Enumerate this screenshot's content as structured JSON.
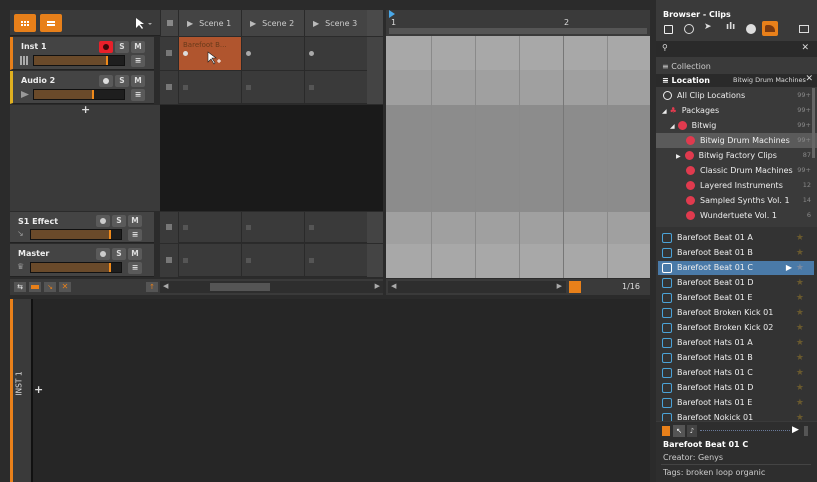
{
  "colors": {
    "accent": "#f08a1a",
    "record": "#e8202a",
    "selected_row": "#4a7aa8",
    "browser_icon": "#e03a4e"
  },
  "scenes": [
    {
      "label": "Scene 1"
    },
    {
      "label": "Scene 2"
    },
    {
      "label": "Scene 3"
    }
  ],
  "tracks": [
    {
      "name": "Inst 1",
      "mute": "M",
      "solo": "S"
    },
    {
      "name": "Audio 2",
      "mute": "M",
      "solo": "S"
    },
    {
      "name": "S1 Effect",
      "mute": "M",
      "solo": "S"
    },
    {
      "name": "Master",
      "mute": "M",
      "solo": "S"
    }
  ],
  "clip": {
    "label": "Barefoot B..."
  },
  "arranger": {
    "bar1": "1",
    "bar2": "2",
    "grid": "1/16"
  },
  "bottom": {
    "track_label": "INST 1"
  },
  "browser": {
    "title": "Browser - Clips",
    "collection": "Collection",
    "location": "Location",
    "location_value": "Bitwig Drum Machines",
    "locations": [
      {
        "label": "All Clip Locations",
        "count": "99+"
      },
      {
        "label": "Packages",
        "count": "99+"
      },
      {
        "label": "Bitwig",
        "count": "99+"
      },
      {
        "label": "Bitwig Drum Machines",
        "count": "99+"
      },
      {
        "label": "Bitwig Factory Clips",
        "count": "87"
      },
      {
        "label": "Classic Drum Machines",
        "count": "99+"
      },
      {
        "label": "Layered Instruments",
        "count": "12"
      },
      {
        "label": "Sampled Synths Vol. 1",
        "count": "14"
      },
      {
        "label": "Wundertuete Vol. 1",
        "count": "6"
      }
    ],
    "files": [
      "Barefoot Beat 01 A",
      "Barefoot Beat 01 B",
      "Barefoot Beat 01 C",
      "Barefoot Beat 01 D",
      "Barefoot Beat 01 E",
      "Barefoot Broken Kick 01",
      "Barefoot Broken Kick 02",
      "Barefoot Hats 01 A",
      "Barefoot Hats 01 B",
      "Barefoot Hats 01 C",
      "Barefoot Hats 01 D",
      "Barefoot Hats 01 E",
      "Barefoot Nokick 01"
    ],
    "selected_index": 2,
    "info": {
      "name": "Barefoot Beat 01 C",
      "creator": "Creator: Genys",
      "tags": "Tags: broken loop organic"
    }
  }
}
